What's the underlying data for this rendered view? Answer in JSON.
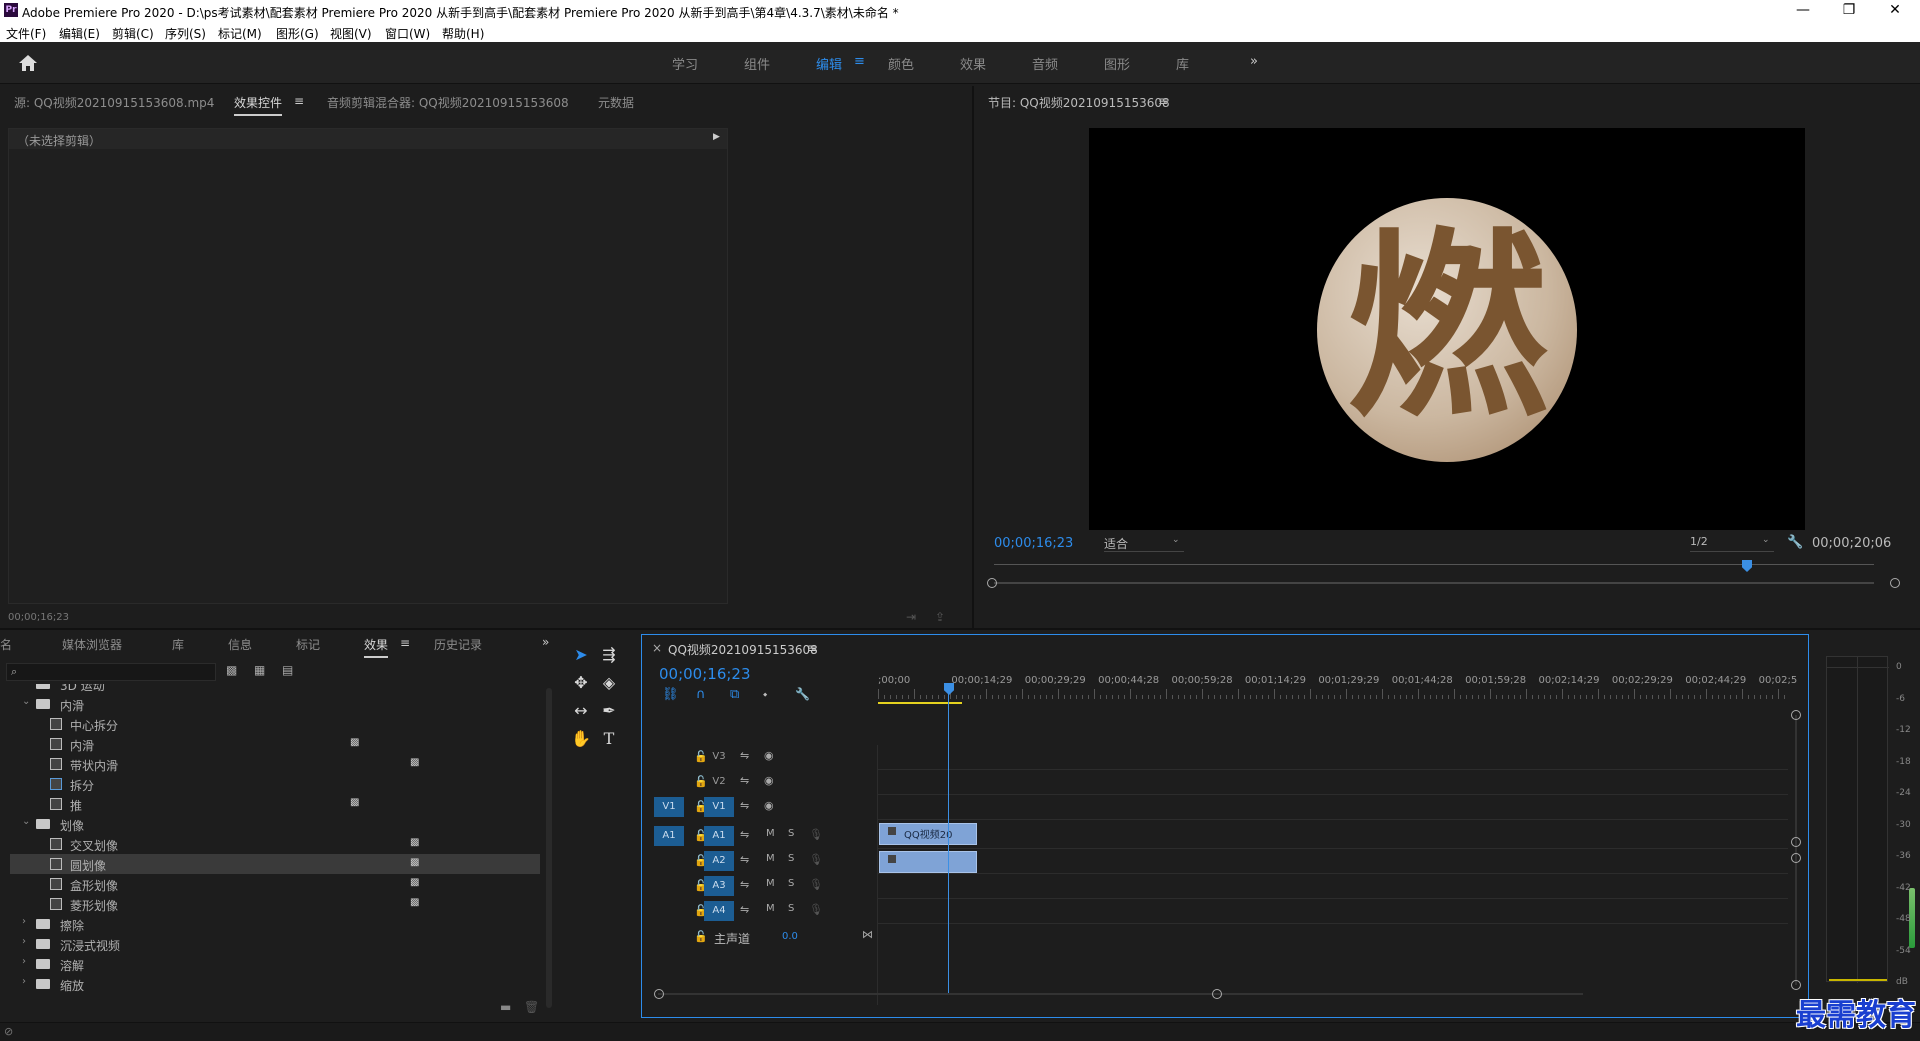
{
  "titlebar": {
    "title": "Adobe Premiere Pro 2020 - D:\\ps考试素材\\配套素材 Premiere Pro 2020 从新手到高手\\配套素材 Premiere Pro 2020 从新手到高手\\第4章\\4.3.7\\素材\\未命名 *",
    "icon": "Pr",
    "min": "—",
    "max": "❐",
    "close": "✕"
  },
  "menubar": [
    "文件(F)",
    "编辑(E)",
    "剪辑(C)",
    "序列(S)",
    "标记(M)",
    "图形(G)",
    "视图(V)",
    "窗口(W)",
    "帮助(H)"
  ],
  "workspaces": [
    "学习",
    "组件",
    "编辑",
    "颜色",
    "效果",
    "音频",
    "图形",
    "库"
  ],
  "workspace_more": "»",
  "source_panel": {
    "tabs": [
      "源: QQ视频20210915153608.mp4",
      "效果控件",
      "音频剪辑混合器: QQ视频20210915153608",
      "元数据"
    ],
    "no_clip": "（未选择剪辑）",
    "timecode": "00;00;16;23"
  },
  "program_panel": {
    "title": "节目: QQ视频20210915153608",
    "timecode_left": "00;00;16;23",
    "fit": "适合",
    "resolution": "1/2",
    "timecode_right": "00;00;20;06",
    "video_glyph": "燃"
  },
  "project_panel": {
    "tabs": [
      "名",
      "媒体浏览器",
      "库",
      "信息",
      "标记",
      "效果",
      "历史记录"
    ],
    "more": "»",
    "search_placeholder": ""
  },
  "effects_tree": [
    {
      "type": "folder",
      "label": "3D 运动",
      "indent": 0,
      "open": false,
      "partial": true
    },
    {
      "type": "folder",
      "label": "内滑",
      "indent": 0,
      "open": true
    },
    {
      "type": "fx",
      "label": "中心拆分",
      "indent": 1,
      "acc": ""
    },
    {
      "type": "fx",
      "label": "内滑",
      "indent": 1,
      "acc": "▩",
      "acc_x": "mid"
    },
    {
      "type": "fx",
      "label": "带状内滑",
      "indent": 1,
      "acc": "▩"
    },
    {
      "type": "fx",
      "label": "拆分",
      "indent": 1,
      "acc": ""
    },
    {
      "type": "fx",
      "label": "推",
      "indent": 1,
      "acc": "▩",
      "acc_x": "mid"
    },
    {
      "type": "folder",
      "label": "划像",
      "indent": 0,
      "open": true
    },
    {
      "type": "fx",
      "label": "交叉划像",
      "indent": 1,
      "acc": "▩"
    },
    {
      "type": "fx",
      "label": "圆划像",
      "indent": 1,
      "acc": "▩",
      "selected": true
    },
    {
      "type": "fx",
      "label": "盒形划像",
      "indent": 1,
      "acc": "▩"
    },
    {
      "type": "fx",
      "label": "菱形划像",
      "indent": 1,
      "acc": "▩"
    },
    {
      "type": "folder",
      "label": "擦除",
      "indent": 0,
      "open": false
    },
    {
      "type": "folder",
      "label": "沉浸式视频",
      "indent": 0,
      "open": false
    },
    {
      "type": "folder",
      "label": "溶解",
      "indent": 0,
      "open": false
    },
    {
      "type": "folder",
      "label": "缩放",
      "indent": 0,
      "open": false
    }
  ],
  "timeline": {
    "title": "QQ视频20210915153608",
    "timecode": "00;00;16;23",
    "ruler": [
      ";00;00",
      "00;00;14;29",
      "00;00;29;29",
      "00;00;44;28",
      "00;00;59;28",
      "00;01;14;29",
      "00;01;29;29",
      "00;01;44;28",
      "00;01;59;28",
      "00;02;14;29",
      "00;02;29;29",
      "00;02;44;29",
      "00;02;5"
    ],
    "video_tracks": [
      {
        "src": "",
        "name": "V3"
      },
      {
        "src": "",
        "name": "V2"
      },
      {
        "src": "V1",
        "name": "V1"
      }
    ],
    "audio_tracks": [
      {
        "src": "A1",
        "name": "A1"
      },
      {
        "src": "",
        "name": "A2"
      },
      {
        "src": "",
        "name": "A3"
      },
      {
        "src": "",
        "name": "A4"
      }
    ],
    "master": {
      "label": "主声道",
      "value": "0.0"
    },
    "clip_label": "QQ视频20",
    "m": "M",
    "s": "S"
  },
  "meter": {
    "labels": [
      "0",
      "-6",
      "-12",
      "-18",
      "-24",
      "-30",
      "-36",
      "-42",
      "-48",
      "-54",
      "dB"
    ]
  },
  "watermark": "最需教育",
  "colors": {
    "accent": "#2d8ceb",
    "clip": "#7fa3d6",
    "track_on": "#1c5d93",
    "playhead": "#3b8fe4"
  }
}
